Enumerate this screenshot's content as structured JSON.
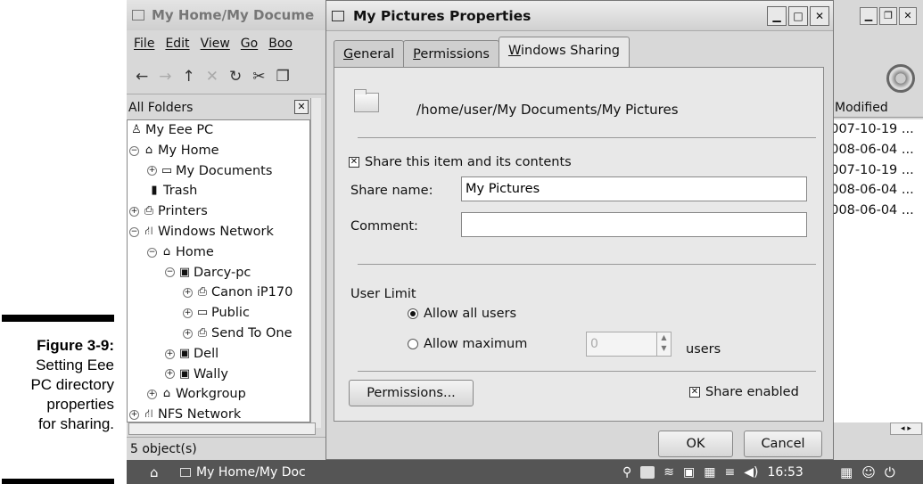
{
  "caption": {
    "figure": "Figure 3-9:",
    "lines": [
      "Setting Eee",
      "PC directory",
      "properties",
      "for sharing."
    ]
  },
  "file_manager": {
    "title": "My Home/My Docume",
    "menu": [
      "File",
      "Edit",
      "View",
      "Go",
      "Boo"
    ],
    "folders_label": "All Folders",
    "tree": [
      {
        "label": "My Eee PC",
        "indent": 0,
        "exp": "",
        "icon": "eee-icon"
      },
      {
        "label": "My Home",
        "indent": 0,
        "exp": "−",
        "icon": "home-icon"
      },
      {
        "label": "My Documents",
        "indent": 1,
        "exp": "+",
        "icon": "folder-icon"
      },
      {
        "label": "Trash",
        "indent": 1,
        "exp": "",
        "icon": "trash-icon"
      },
      {
        "label": "Printers",
        "indent": 0,
        "exp": "+",
        "icon": "printer-icon"
      },
      {
        "label": "Windows Network",
        "indent": 0,
        "exp": "−",
        "icon": "network-icon"
      },
      {
        "label": "Home",
        "indent": 1,
        "exp": "−",
        "icon": "workgroup-icon"
      },
      {
        "label": "Darcy-pc",
        "indent": 2,
        "exp": "−",
        "icon": "computer-icon"
      },
      {
        "label": "Canon iP170",
        "indent": 3,
        "exp": "+",
        "icon": "printer-share-icon"
      },
      {
        "label": "Public",
        "indent": 3,
        "exp": "+",
        "icon": "folder-icon"
      },
      {
        "label": "Send To One",
        "indent": 3,
        "exp": "+",
        "icon": "printer-share-icon"
      },
      {
        "label": "Dell",
        "indent": 2,
        "exp": "+",
        "icon": "computer-icon"
      },
      {
        "label": "Wally",
        "indent": 2,
        "exp": "+",
        "icon": "computer-icon"
      },
      {
        "label": "Workgroup",
        "indent": 1,
        "exp": "+",
        "icon": "workgroup-icon"
      },
      {
        "label": "NFS Network",
        "indent": 0,
        "exp": "+",
        "icon": "network-icon"
      }
    ],
    "status": "5 object(s)"
  },
  "right_list": {
    "column": "Modified",
    "rows": [
      "2007-10-19 ...",
      "2008-06-04 ...",
      "2007-10-19 ...",
      "2008-06-04 ...",
      "2008-06-04 ..."
    ]
  },
  "dialog": {
    "title": "My Pictures Properties",
    "tabs": [
      {
        "label": "General",
        "key": "G",
        "rest": "eneral",
        "active": false
      },
      {
        "label": "Permissions",
        "key": "P",
        "rest": "ermissions",
        "active": false
      },
      {
        "label": "Windows Sharing",
        "key": "W",
        "rest": "indows Sharing",
        "active": true
      }
    ],
    "path": "/home/user/My Documents/My Pictures",
    "share_item_label": "Share this item and its contents",
    "share_item_checked": true,
    "share_name_label": "Share name:",
    "share_name_value": "My Pictures",
    "comment_label": "Comment:",
    "comment_value": "",
    "user_limit_label": "User Limit",
    "allow_all_label": "Allow all users",
    "allow_max_label": "Allow maximum",
    "max_users_value": "0",
    "users_label": "users",
    "permissions_button": "Permissions...",
    "share_enabled_label": "Share enabled",
    "share_enabled_checked": true,
    "ok_button": "OK",
    "cancel_button": "Cancel"
  },
  "taskbar": {
    "task_label": "My Home/My Doc",
    "clock": "16:53"
  }
}
